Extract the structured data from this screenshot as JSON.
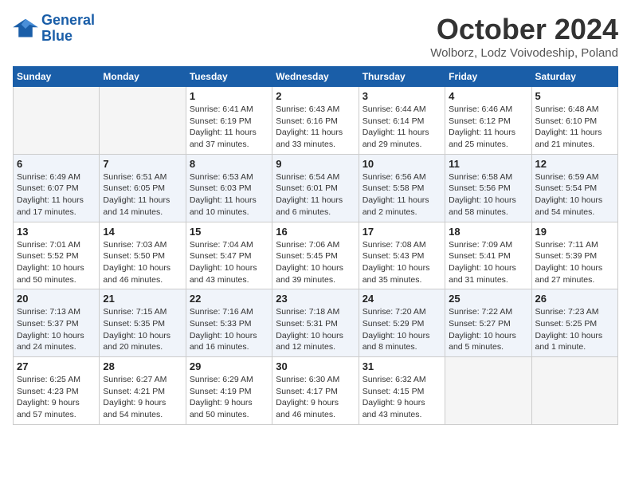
{
  "logo": {
    "line1": "General",
    "line2": "Blue"
  },
  "title": "October 2024",
  "subtitle": "Wolborz, Lodz Voivodeship, Poland",
  "weekdays": [
    "Sunday",
    "Monday",
    "Tuesday",
    "Wednesday",
    "Thursday",
    "Friday",
    "Saturday"
  ],
  "weeks": [
    [
      {
        "day": "",
        "info": ""
      },
      {
        "day": "",
        "info": ""
      },
      {
        "day": "1",
        "info": "Sunrise: 6:41 AM\nSunset: 6:19 PM\nDaylight: 11 hours\nand 37 minutes."
      },
      {
        "day": "2",
        "info": "Sunrise: 6:43 AM\nSunset: 6:16 PM\nDaylight: 11 hours\nand 33 minutes."
      },
      {
        "day": "3",
        "info": "Sunrise: 6:44 AM\nSunset: 6:14 PM\nDaylight: 11 hours\nand 29 minutes."
      },
      {
        "day": "4",
        "info": "Sunrise: 6:46 AM\nSunset: 6:12 PM\nDaylight: 11 hours\nand 25 minutes."
      },
      {
        "day": "5",
        "info": "Sunrise: 6:48 AM\nSunset: 6:10 PM\nDaylight: 11 hours\nand 21 minutes."
      }
    ],
    [
      {
        "day": "6",
        "info": "Sunrise: 6:49 AM\nSunset: 6:07 PM\nDaylight: 11 hours\nand 17 minutes."
      },
      {
        "day": "7",
        "info": "Sunrise: 6:51 AM\nSunset: 6:05 PM\nDaylight: 11 hours\nand 14 minutes."
      },
      {
        "day": "8",
        "info": "Sunrise: 6:53 AM\nSunset: 6:03 PM\nDaylight: 11 hours\nand 10 minutes."
      },
      {
        "day": "9",
        "info": "Sunrise: 6:54 AM\nSunset: 6:01 PM\nDaylight: 11 hours\nand 6 minutes."
      },
      {
        "day": "10",
        "info": "Sunrise: 6:56 AM\nSunset: 5:58 PM\nDaylight: 11 hours\nand 2 minutes."
      },
      {
        "day": "11",
        "info": "Sunrise: 6:58 AM\nSunset: 5:56 PM\nDaylight: 10 hours\nand 58 minutes."
      },
      {
        "day": "12",
        "info": "Sunrise: 6:59 AM\nSunset: 5:54 PM\nDaylight: 10 hours\nand 54 minutes."
      }
    ],
    [
      {
        "day": "13",
        "info": "Sunrise: 7:01 AM\nSunset: 5:52 PM\nDaylight: 10 hours\nand 50 minutes."
      },
      {
        "day": "14",
        "info": "Sunrise: 7:03 AM\nSunset: 5:50 PM\nDaylight: 10 hours\nand 46 minutes."
      },
      {
        "day": "15",
        "info": "Sunrise: 7:04 AM\nSunset: 5:47 PM\nDaylight: 10 hours\nand 43 minutes."
      },
      {
        "day": "16",
        "info": "Sunrise: 7:06 AM\nSunset: 5:45 PM\nDaylight: 10 hours\nand 39 minutes."
      },
      {
        "day": "17",
        "info": "Sunrise: 7:08 AM\nSunset: 5:43 PM\nDaylight: 10 hours\nand 35 minutes."
      },
      {
        "day": "18",
        "info": "Sunrise: 7:09 AM\nSunset: 5:41 PM\nDaylight: 10 hours\nand 31 minutes."
      },
      {
        "day": "19",
        "info": "Sunrise: 7:11 AM\nSunset: 5:39 PM\nDaylight: 10 hours\nand 27 minutes."
      }
    ],
    [
      {
        "day": "20",
        "info": "Sunrise: 7:13 AM\nSunset: 5:37 PM\nDaylight: 10 hours\nand 24 minutes."
      },
      {
        "day": "21",
        "info": "Sunrise: 7:15 AM\nSunset: 5:35 PM\nDaylight: 10 hours\nand 20 minutes."
      },
      {
        "day": "22",
        "info": "Sunrise: 7:16 AM\nSunset: 5:33 PM\nDaylight: 10 hours\nand 16 minutes."
      },
      {
        "day": "23",
        "info": "Sunrise: 7:18 AM\nSunset: 5:31 PM\nDaylight: 10 hours\nand 12 minutes."
      },
      {
        "day": "24",
        "info": "Sunrise: 7:20 AM\nSunset: 5:29 PM\nDaylight: 10 hours\nand 8 minutes."
      },
      {
        "day": "25",
        "info": "Sunrise: 7:22 AM\nSunset: 5:27 PM\nDaylight: 10 hours\nand 5 minutes."
      },
      {
        "day": "26",
        "info": "Sunrise: 7:23 AM\nSunset: 5:25 PM\nDaylight: 10 hours\nand 1 minute."
      }
    ],
    [
      {
        "day": "27",
        "info": "Sunrise: 6:25 AM\nSunset: 4:23 PM\nDaylight: 9 hours\nand 57 minutes."
      },
      {
        "day": "28",
        "info": "Sunrise: 6:27 AM\nSunset: 4:21 PM\nDaylight: 9 hours\nand 54 minutes."
      },
      {
        "day": "29",
        "info": "Sunrise: 6:29 AM\nSunset: 4:19 PM\nDaylight: 9 hours\nand 50 minutes."
      },
      {
        "day": "30",
        "info": "Sunrise: 6:30 AM\nSunset: 4:17 PM\nDaylight: 9 hours\nand 46 minutes."
      },
      {
        "day": "31",
        "info": "Sunrise: 6:32 AM\nSunset: 4:15 PM\nDaylight: 9 hours\nand 43 minutes."
      },
      {
        "day": "",
        "info": ""
      },
      {
        "day": "",
        "info": ""
      }
    ]
  ]
}
